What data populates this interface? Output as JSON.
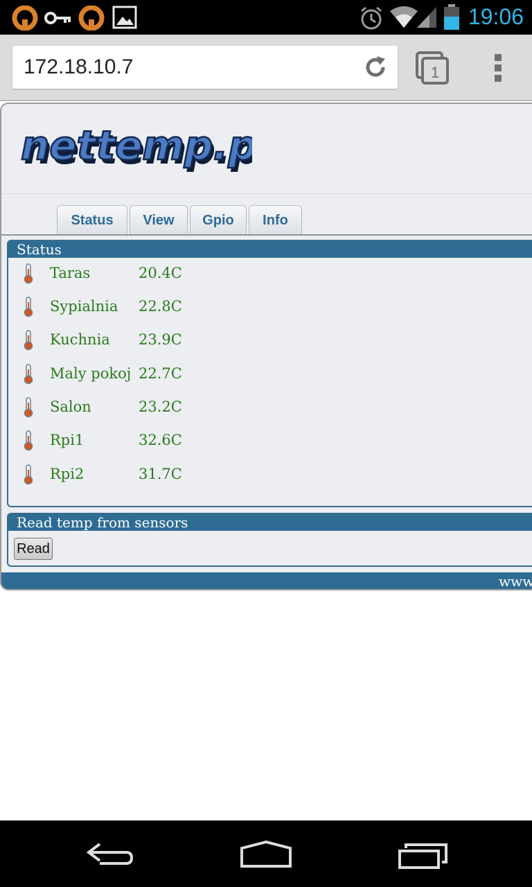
{
  "status_bar": {
    "time": "19:06",
    "icons": [
      "openvpn-icon",
      "key-icon",
      "openvpn-icon",
      "image-icon",
      "alarm-icon",
      "wifi-icon",
      "signal-icon",
      "battery-icon"
    ]
  },
  "browser": {
    "url": "172.18.10.7",
    "tab_count": "1"
  },
  "page": {
    "logo_text": "nettemp.pl",
    "tabs": [
      {
        "label": "Status"
      },
      {
        "label": "View"
      },
      {
        "label": "Gpio"
      },
      {
        "label": "Info"
      }
    ],
    "status_panel": {
      "title": "Status",
      "sensors": [
        {
          "name": "Taras",
          "value": "20.4C"
        },
        {
          "name": "Sypialnia",
          "value": "22.8C"
        },
        {
          "name": "Kuchnia",
          "value": "23.9C"
        },
        {
          "name": "Maly pokoj",
          "value": "22.7C"
        },
        {
          "name": "Salon",
          "value": "23.2C"
        },
        {
          "name": "Rpi1",
          "value": "32.6C"
        },
        {
          "name": "Rpi2",
          "value": "31.7C"
        }
      ]
    },
    "read_panel": {
      "title": "Read temp from sensors",
      "button_label": "Read"
    },
    "footer_text": "www"
  },
  "colors": {
    "accent": "#2f6c93",
    "sensor_text": "#2a7a1c",
    "time": "#33b5e5"
  }
}
